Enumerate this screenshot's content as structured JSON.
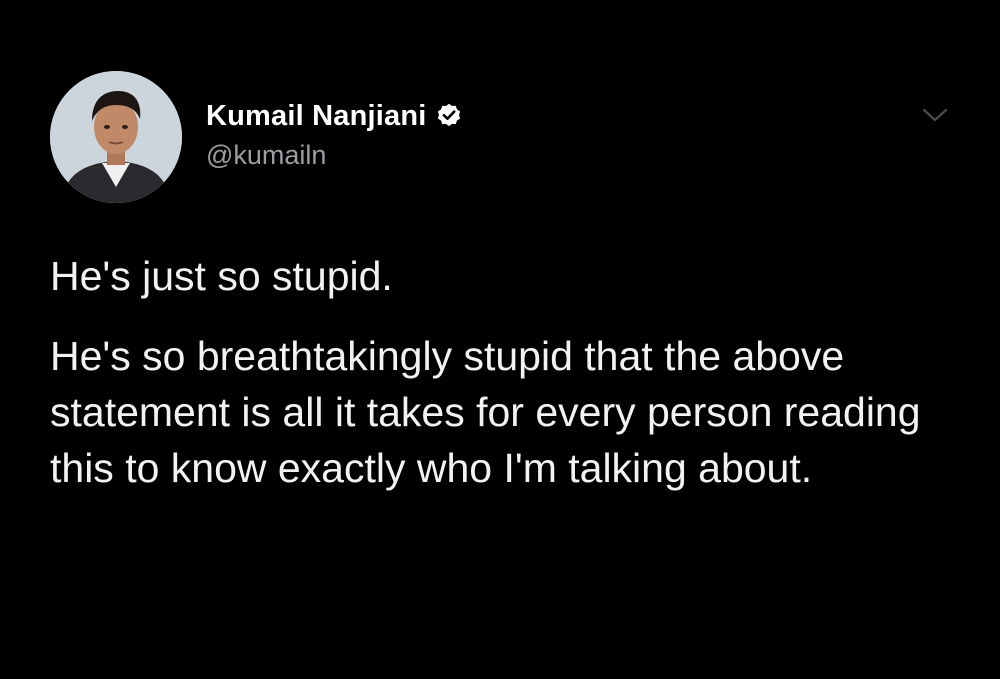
{
  "author": {
    "display_name": "Kumail Nanjiani",
    "handle": "@kumailn",
    "verified": true,
    "avatar_icon": "profile-photo"
  },
  "tweet": {
    "paragraphs": [
      "He's just so stupid.",
      "He's so breathtakingly stupid that the above statement is all it takes for every person reading this to know exactly who I'm talking about."
    ]
  },
  "menu": {
    "icon": "chevron-down-icon"
  },
  "colors": {
    "background": "#000000",
    "name_text": "#ffffff",
    "handle_text": "#9a9ea3",
    "body_text": "#f2f2f2",
    "verified_badge": "#ffffff"
  }
}
